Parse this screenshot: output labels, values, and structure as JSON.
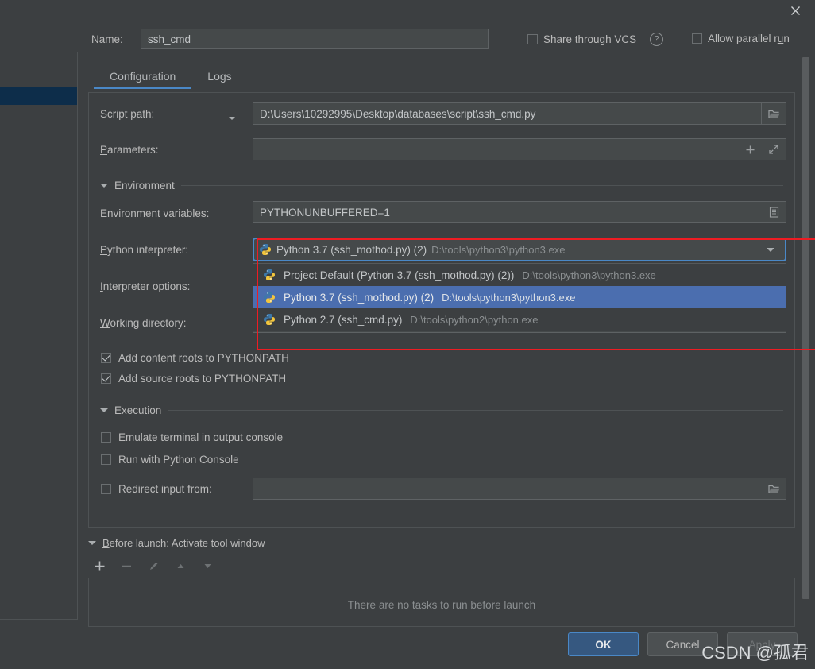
{
  "window": {
    "close_icon": "close-icon"
  },
  "name_row": {
    "label": "Name:",
    "label_mnemonic": "N",
    "label_rest": "ame:",
    "value": "ssh_cmd",
    "share_vcs_label": "Share through VCS",
    "share_vcs_checked": false,
    "help_icon": "?",
    "allow_parallel_label": "Allow parallel run",
    "allow_parallel_checked": false
  },
  "tabs": [
    {
      "label": "Configuration",
      "active": true
    },
    {
      "label": "Logs",
      "active": false
    }
  ],
  "script_path": {
    "label": "Script path:",
    "value": "D:\\Users\\10292995\\Desktop\\databases\\script\\ssh_cmd.py",
    "browse_icon": "folder-icon"
  },
  "parameters": {
    "label": "Parameters:",
    "label_mnemonic": "P",
    "label_rest": "arameters:",
    "value": "",
    "insert_icon": "plus-icon",
    "expand_icon": "expand-icon"
  },
  "environment_section": {
    "title": "Environment"
  },
  "environment_variables": {
    "label": "Environment variables:",
    "label_mnemonic": "E",
    "label_rest": "nvironment variables:",
    "value": "PYTHONUNBUFFERED=1",
    "edit_icon": "list-edit-icon"
  },
  "python_interpreter": {
    "label": "Python interpreter:",
    "label_mnemonic": "P",
    "label_rest": "ython interpreter:",
    "selected_text": "Python 3.7 (ssh_mothod.py) (2)",
    "selected_path": "D:\\tools\\python3\\python3.exe",
    "arrow_icon": "chevron-down-icon",
    "options": [
      {
        "text": "Project Default (Python 3.7 (ssh_mothod.py) (2))",
        "path": "D:\\tools\\python3\\python3.exe",
        "selected": false
      },
      {
        "text": "Python 3.7 (ssh_mothod.py) (2)",
        "path": "D:\\tools\\python3\\python3.exe",
        "selected": true
      },
      {
        "text": "Python 2.7 (ssh_cmd.py)",
        "path": "D:\\tools\\python2\\python.exe",
        "selected": false
      }
    ]
  },
  "interpreter_options": {
    "label": "Interpreter options:",
    "label_mnemonic": "I",
    "label_rest": "nterpreter options:",
    "value": ""
  },
  "working_directory": {
    "label": "Working directory:",
    "label_mnemonic": "W",
    "label_rest": "orking directory:",
    "value": ""
  },
  "path_checkboxes": [
    {
      "label": "Add content roots to PYTHONPATH",
      "checked": true
    },
    {
      "label": "Add source roots to PYTHONPATH",
      "checked": true
    }
  ],
  "execution_section": {
    "title": "Execution"
  },
  "execution_checkboxes": [
    {
      "label": "Emulate terminal in output console",
      "checked": false
    },
    {
      "label": "Run with Python Console",
      "checked": false
    }
  ],
  "redirect_input": {
    "label": "Redirect input from:",
    "checked": false,
    "value": "",
    "browse_icon": "folder-icon"
  },
  "before_launch": {
    "title": "Before launch: Activate tool window",
    "title_mnemonic": "B",
    "title_rest": "efore launch: Activate tool window",
    "toolbar": [
      {
        "name": "add-task-button",
        "glyph": "+",
        "enabled": true
      },
      {
        "name": "remove-task-button",
        "glyph": "−",
        "enabled": false
      },
      {
        "name": "edit-task-button",
        "glyph": "╱",
        "enabled": false
      },
      {
        "name": "move-up-button",
        "glyph": "▲",
        "enabled": false
      },
      {
        "name": "move-down-button",
        "glyph": "▼",
        "enabled": false
      }
    ],
    "empty_message": "There are no tasks to run before launch"
  },
  "buttons": {
    "ok": "OK",
    "cancel": "Cancel",
    "apply": "Apply",
    "apply_enabled": false
  },
  "watermark": "CSDN @孤君",
  "colors": {
    "background": "#3c3f41",
    "field_background": "#45494a",
    "accent_blue": "#4a88c7",
    "selection_blue": "#4b6eaf",
    "primary_button": "#365880",
    "annotation_red": "#ee1c23",
    "tree_selection": "#0d2d4a",
    "muted_text": "#8b8f91"
  }
}
